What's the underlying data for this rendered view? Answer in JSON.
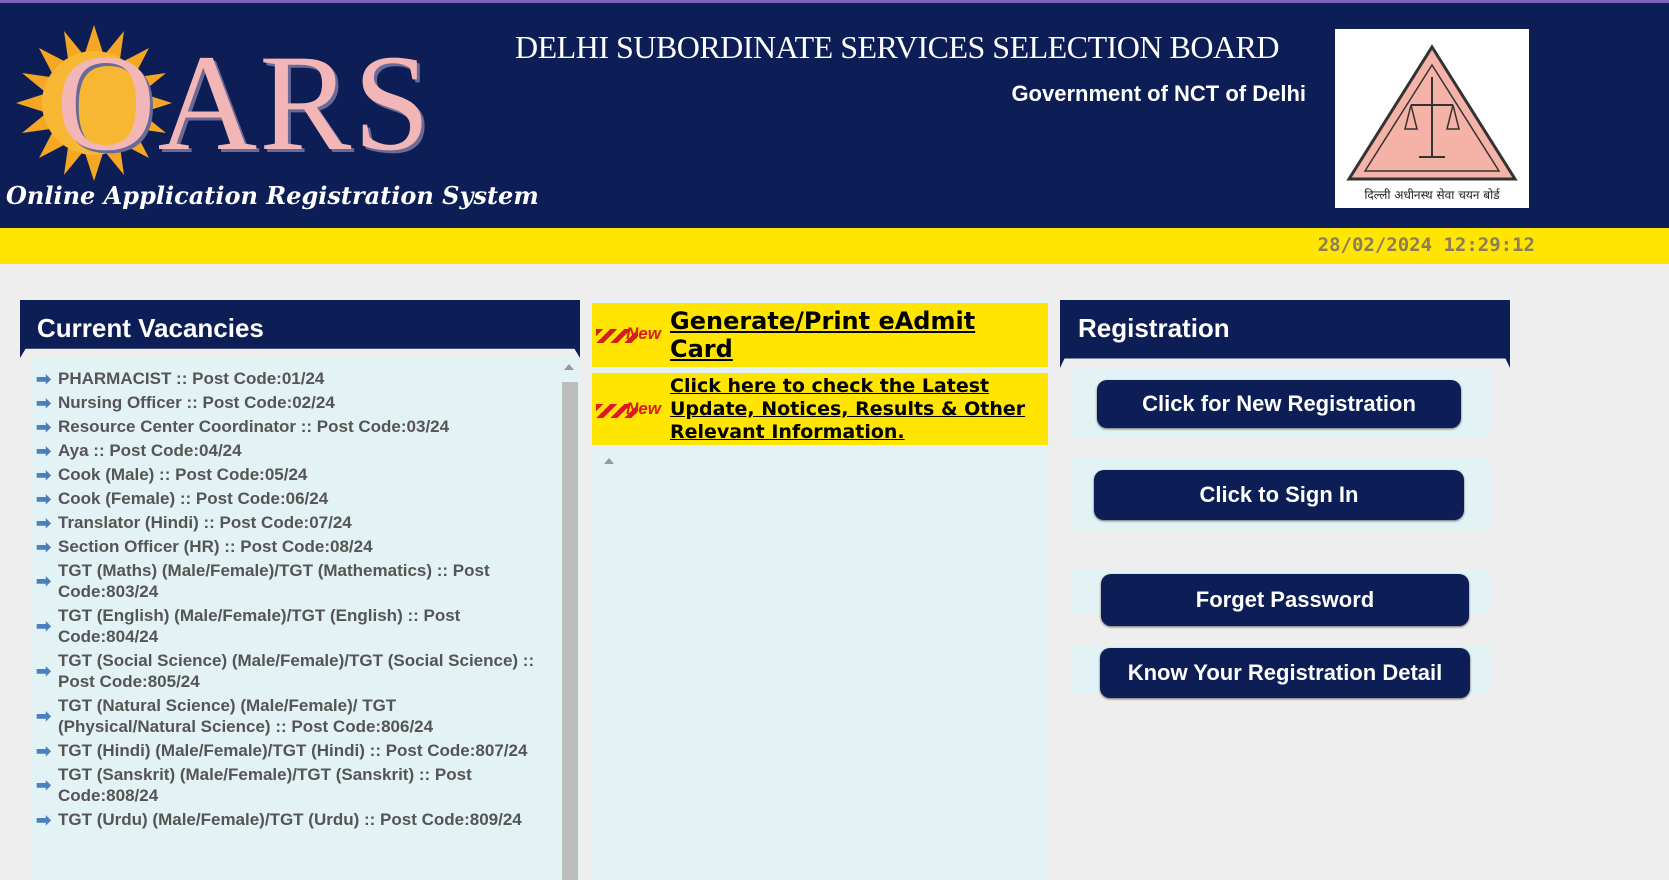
{
  "header": {
    "logo_text": "OARS",
    "tagline": "Online Application Registration System",
    "board_title": "DELHI SUBORDINATE SERVICES SELECTION BOARD",
    "gov_title": "Government of NCT of Delhi",
    "emblem_text": "दिल्ली अधीनस्थ सेवा चयन बोर्ड"
  },
  "datetime": "28/02/2024 12:29:12",
  "vacancies": {
    "title": "Current Vacancies",
    "items": [
      "PHARMACIST :: Post Code:01/24",
      "Nursing Officer :: Post Code:02/24",
      "Resource Center Coordinator :: Post Code:03/24",
      "Aya :: Post Code:04/24",
      "Cook (Male) :: Post Code:05/24",
      "Cook (Female) :: Post Code:06/24",
      "Translator (Hindi) :: Post Code:07/24",
      "Section Officer (HR) :: Post Code:08/24",
      "TGT (Maths) (Male/Female)/TGT (Mathematics) :: Post Code:803/24",
      "TGT (English) (Male/Female)/TGT (English) :: Post Code:804/24",
      "TGT (Social Science) (Male/Female)/TGT (Social Science) :: Post Code:805/24",
      "TGT (Natural Science) (Male/Female)/ TGT (Physical/Natural Science) :: Post Code:806/24",
      "TGT (Hindi) (Male/Female)/TGT (Hindi) :: Post Code:807/24",
      "TGT (Sanskrit) (Male/Female)/TGT (Sanskrit) :: Post Code:808/24",
      "TGT (Urdu) (Male/Female)/TGT (Urdu) :: Post Code:809/24"
    ]
  },
  "news": {
    "badge": "New",
    "items": [
      "Generate/Print eAdmit Card",
      "Click here to check the Latest Update, Notices, Results & Other Relevant Information."
    ]
  },
  "registration": {
    "title": "Registration",
    "new_registration": "Click for New Registration",
    "sign_in": "Click to Sign In",
    "forget_password": "Forget Password",
    "know_registration": "Know Your Registration Detail"
  },
  "colors": {
    "navy": "#0c1e55",
    "yellow": "#ffe500",
    "panel_bg": "#e3f2f4",
    "logo_pink": "#f2b6b6",
    "sun_orange": "#f5a623"
  }
}
